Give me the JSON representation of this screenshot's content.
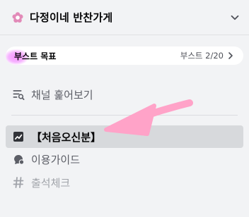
{
  "header": {
    "server_name": "다정이네 반찬가게",
    "server_icon": "flower-icon",
    "menu_icon": "chevron-down-icon"
  },
  "boost": {
    "goal_label": "부스트 목표",
    "progress_label": "부스트 2/20",
    "progress_value": 0.1
  },
  "channels": [
    {
      "label": "채널 훑어보기",
      "icon": "browse-channels-icon",
      "state": "normal"
    },
    {
      "label": "【처음오신분】",
      "icon": "checklist-icon",
      "state": "selected"
    },
    {
      "label": "이용가이드",
      "icon": "forum-icon",
      "state": "normal"
    },
    {
      "label": "출석체크",
      "icon": "hash-icon",
      "state": "muted"
    }
  ],
  "colors": {
    "sidebar_bg": "#f2f3f5",
    "selected_bg": "#d7d9dc",
    "boost_pink": "#f47fff",
    "annotation_arrow": "#ffa3c8"
  }
}
